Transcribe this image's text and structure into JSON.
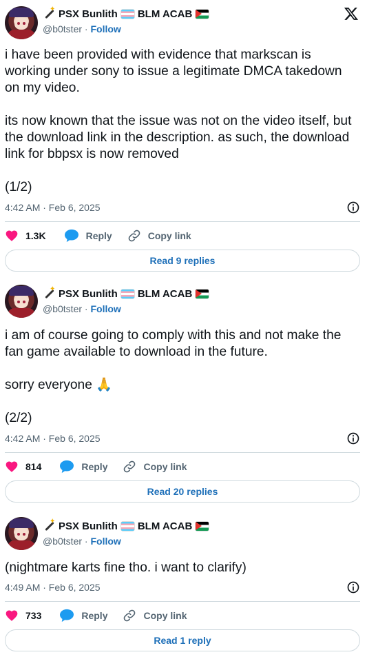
{
  "tweets": [
    {
      "display_name": "PSX Bunlith",
      "name_suffix": "BLM ACAB",
      "handle": "@b0tster",
      "separator": "·",
      "follow_label": "Follow",
      "text": "i have been provided with evidence that markscan is working under sony to issue a legitimate DMCA takedown on my video.\n\nits now known that the issue was not on the video itself, but the download link in the description. as such, the download link for bbpsx is now removed\n\n(1/2)",
      "time": "4:42 AM · Feb 6, 2025",
      "likes": "1.3K",
      "reply_label": "Reply",
      "copy_label": "Copy link",
      "read_label": "Read 9 replies"
    },
    {
      "display_name": "PSX Bunlith",
      "name_suffix": "BLM ACAB",
      "handle": "@b0tster",
      "separator": "·",
      "follow_label": "Follow",
      "text": "i am of course going to comply with this and not make the fan game available to download in the future.\n\nsorry everyone 🙏\n\n(2/2)",
      "time": "4:42 AM · Feb 6, 2025",
      "likes": "814",
      "reply_label": "Reply",
      "copy_label": "Copy link",
      "read_label": "Read 20 replies"
    },
    {
      "display_name": "PSX Bunlith",
      "name_suffix": "BLM ACAB",
      "handle": "@b0tster",
      "separator": "·",
      "follow_label": "Follow",
      "text": "(nightmare karts fine tho. i want to clarify)",
      "time": "4:49 AM · Feb 6, 2025",
      "likes": "733",
      "reply_label": "Reply",
      "copy_label": "Copy link",
      "read_label": "Read 1 reply"
    }
  ],
  "icons": {
    "heart": "heart-icon",
    "reply": "reply-bubble-icon",
    "link": "link-icon",
    "info": "info-icon",
    "brand": "x-logo"
  },
  "colors": {
    "heart": "#f91880",
    "reply": "#1d9bf0",
    "link_blue": "#1d6fb8",
    "muted": "#536471",
    "border": "#cfd9de"
  }
}
